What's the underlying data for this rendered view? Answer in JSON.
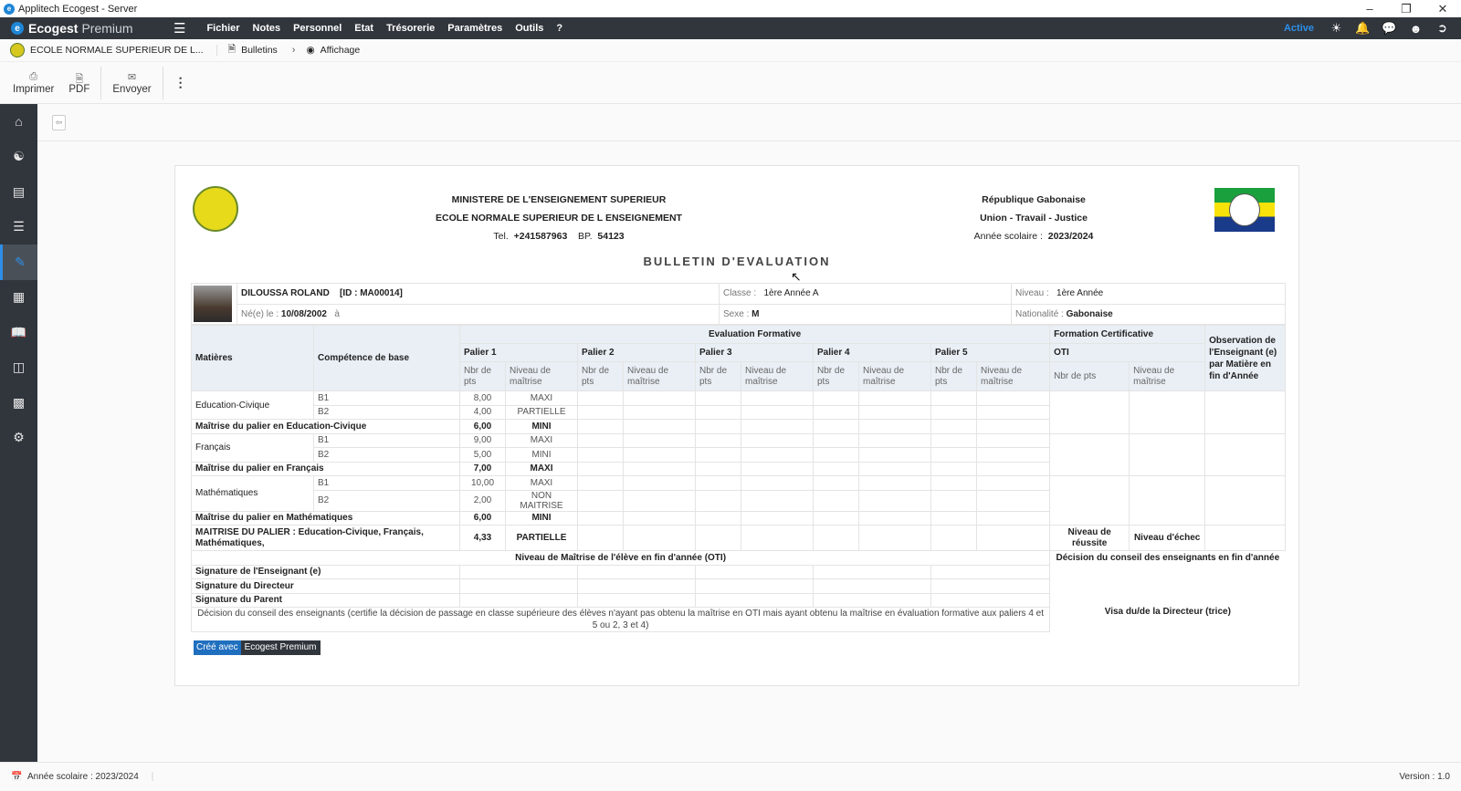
{
  "window": {
    "title": "Applitech Ecogest - Server",
    "controls": [
      "minimize",
      "restore",
      "close"
    ]
  },
  "topbar": {
    "brand_bold": "Ecogest",
    "brand_light": "Premium",
    "menu": [
      "Fichier",
      "Notes",
      "Personnel",
      "Etat",
      "Trésorerie",
      "Paramètres",
      "Outils",
      "?"
    ],
    "status": "Active",
    "status_color": "#2e8fe8"
  },
  "breadcrumb": {
    "school": "ECOLE NORMALE SUPERIEUR DE L...",
    "items": [
      "Bulletins",
      "Affichage"
    ]
  },
  "toolbar": {
    "print": "Imprimer",
    "pdf": "PDF",
    "send": "Envoyer"
  },
  "sidebar": {
    "items": [
      "home",
      "student",
      "card",
      "list",
      "edit",
      "building",
      "book",
      "presentation",
      "wallet",
      "settings"
    ],
    "selected": "edit"
  },
  "report": {
    "ministry": "MINISTERE DE L'ENSEIGNEMENT SUPERIEUR",
    "school": "ECOLE NORMALE SUPERIEUR DE L ENSEIGNEMENT",
    "tel_label": "Tel.",
    "tel": "+241587963",
    "bp_label": "BP.",
    "bp": "54123",
    "republic": "République Gabonaise",
    "motto": "Union - Travail - Justice",
    "year_label": "Année scolaire :",
    "year": "2023/2024",
    "title": "BULLETIN D'EVALUATION",
    "student": {
      "name": "DILOUSSA ROLAND",
      "id": "[ID : MA00014]",
      "born_label": "Né(e) le :",
      "born": "10/08/2002",
      "born_at": "à",
      "class_label": "Classe :",
      "class": "1ère Année A",
      "level_label": "Niveau :",
      "level": "1ère Année",
      "sex_label": "Sexe :",
      "sex": "M",
      "nationality_label": "Nationalité :",
      "nationality": "Gabonaise"
    },
    "headers": {
      "subjects": "Matières",
      "competence": "Compétence de base",
      "formative": "Evaluation Formative",
      "paliers": [
        "Palier 1",
        "Palier 2",
        "Palier 3",
        "Palier 4",
        "Palier 5"
      ],
      "pts": "Nbr de pts",
      "mastery": "Niveau de maîtrise",
      "certif": "Formation Certificative",
      "oti": "OTI",
      "observation": "Observation de l'Enseignant (e) par Matière en fin d'Année"
    },
    "subjects": [
      {
        "name": "Education-Civique",
        "rows": [
          {
            "comp": "B1",
            "pts": "8,00",
            "level": "MAXI"
          },
          {
            "comp": "B2",
            "pts": "4,00",
            "level": "PARTIELLE"
          }
        ],
        "summary": {
          "label": "Maîtrise du palier en Education-Civique",
          "pts": "6,00",
          "level": "MINI"
        }
      },
      {
        "name": "Français",
        "rows": [
          {
            "comp": "B1",
            "pts": "9,00",
            "level": "MAXI"
          },
          {
            "comp": "B2",
            "pts": "5,00",
            "level": "MINI"
          }
        ],
        "summary": {
          "label": "Maîtrise du palier en Français",
          "pts": "7,00",
          "level": "MAXI"
        }
      },
      {
        "name": "Mathématiques",
        "rows": [
          {
            "comp": "B1",
            "pts": "10,00",
            "level": "MAXI"
          },
          {
            "comp": "B2",
            "pts": "2,00",
            "level": "NON MAITRISE"
          }
        ],
        "summary": {
          "label": "Maîtrise du palier en Mathématiques",
          "pts": "6,00",
          "level": "MINI"
        }
      }
    ],
    "overall": {
      "label": "MAITRISE DU PALIER : Education-Civique, Français, Mathématiques,",
      "pts": "4,33",
      "level": "PARTIELLE"
    },
    "success_level": "Niveau de réussite",
    "fail_level": "Niveau d'échec",
    "oti_level": "Niveau de Maîtrise de l'élève en fin d'année (OTI)",
    "council_decision_title": "Décision du conseil des enseignants en fin d'année",
    "signatures": [
      "Signature de l'Enseignant (e)",
      "Signature du Directeur",
      "Signature du Parent"
    ],
    "council_note": "Décision du conseil des enseignants (certifie la décision de passage en classe supérieure des élèves n'ayant pas obtenu la maîtrise en OTI mais ayant obtenu la maîtrise en évaluation formative aux paliers 4 et 5 ou 2, 3 et 4)",
    "visa": "Visa du/de la Directeur (trice)",
    "credit_a": "Créé avec",
    "credit_b": "Ecogest Premium"
  },
  "statusbar": {
    "year_label": "Année scolaire :",
    "year": "2023/2024",
    "version": "Version : 1.0"
  }
}
